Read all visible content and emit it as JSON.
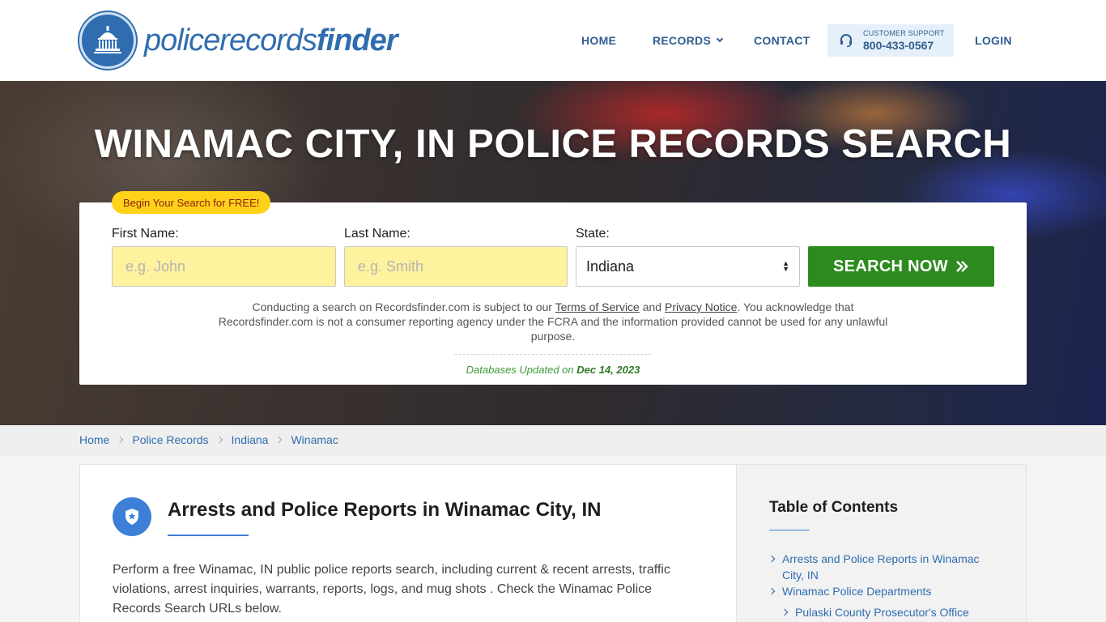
{
  "header": {
    "logo": {
      "part1": "policerecords",
      "part2": "finder"
    },
    "nav": {
      "home": "HOME",
      "records": "RECORDS",
      "contact": "CONTACT",
      "login": "LOGIN"
    },
    "support": {
      "label": "CUSTOMER SUPPORT",
      "phone": "800-433-0567"
    }
  },
  "hero": {
    "title": "WINAMAC CITY, IN POLICE RECORDS SEARCH",
    "badge": "Begin Your Search for FREE!",
    "first_name": {
      "label": "First Name:",
      "placeholder": "e.g. John"
    },
    "last_name": {
      "label": "Last Name:",
      "placeholder": "e.g. Smith"
    },
    "state": {
      "label": "State:",
      "value": "Indiana"
    },
    "search_button": "SEARCH NOW",
    "disclaimer": {
      "pre": "Conducting a search on Recordsfinder.com is subject to our ",
      "tos": "Terms of Service",
      "and": " and ",
      "privacy": "Privacy Notice",
      "post": ". You acknowledge that Recordsfinder.com is not a consumer reporting agency under the FCRA and the information provided cannot be used for any unlawful purpose."
    },
    "db_updated": {
      "label": "Databases Updated on ",
      "date": "Dec 14, 2023"
    }
  },
  "breadcrumb": [
    "Home",
    "Police Records",
    "Indiana",
    "Winamac"
  ],
  "main": {
    "title": "Arrests and Police Reports in Winamac City, IN",
    "text": "Perform a free Winamac, IN public police reports search, including current & recent arrests, traffic violations, arrest inquiries, warrants, reports, logs, and mug shots . Check the Winamac Police Records Search URLs below."
  },
  "toc": {
    "title": "Table of Contents",
    "items": [
      "Arrests and Police Reports in Winamac City, IN",
      "Winamac Police Departments",
      "Pulaski County Prosecutor's Office"
    ]
  },
  "colors": {
    "brand_blue": "#2f6db0",
    "search_green": "#2d8a1f",
    "badge_yellow": "#ffd21a",
    "input_yellow": "#fff29e"
  }
}
